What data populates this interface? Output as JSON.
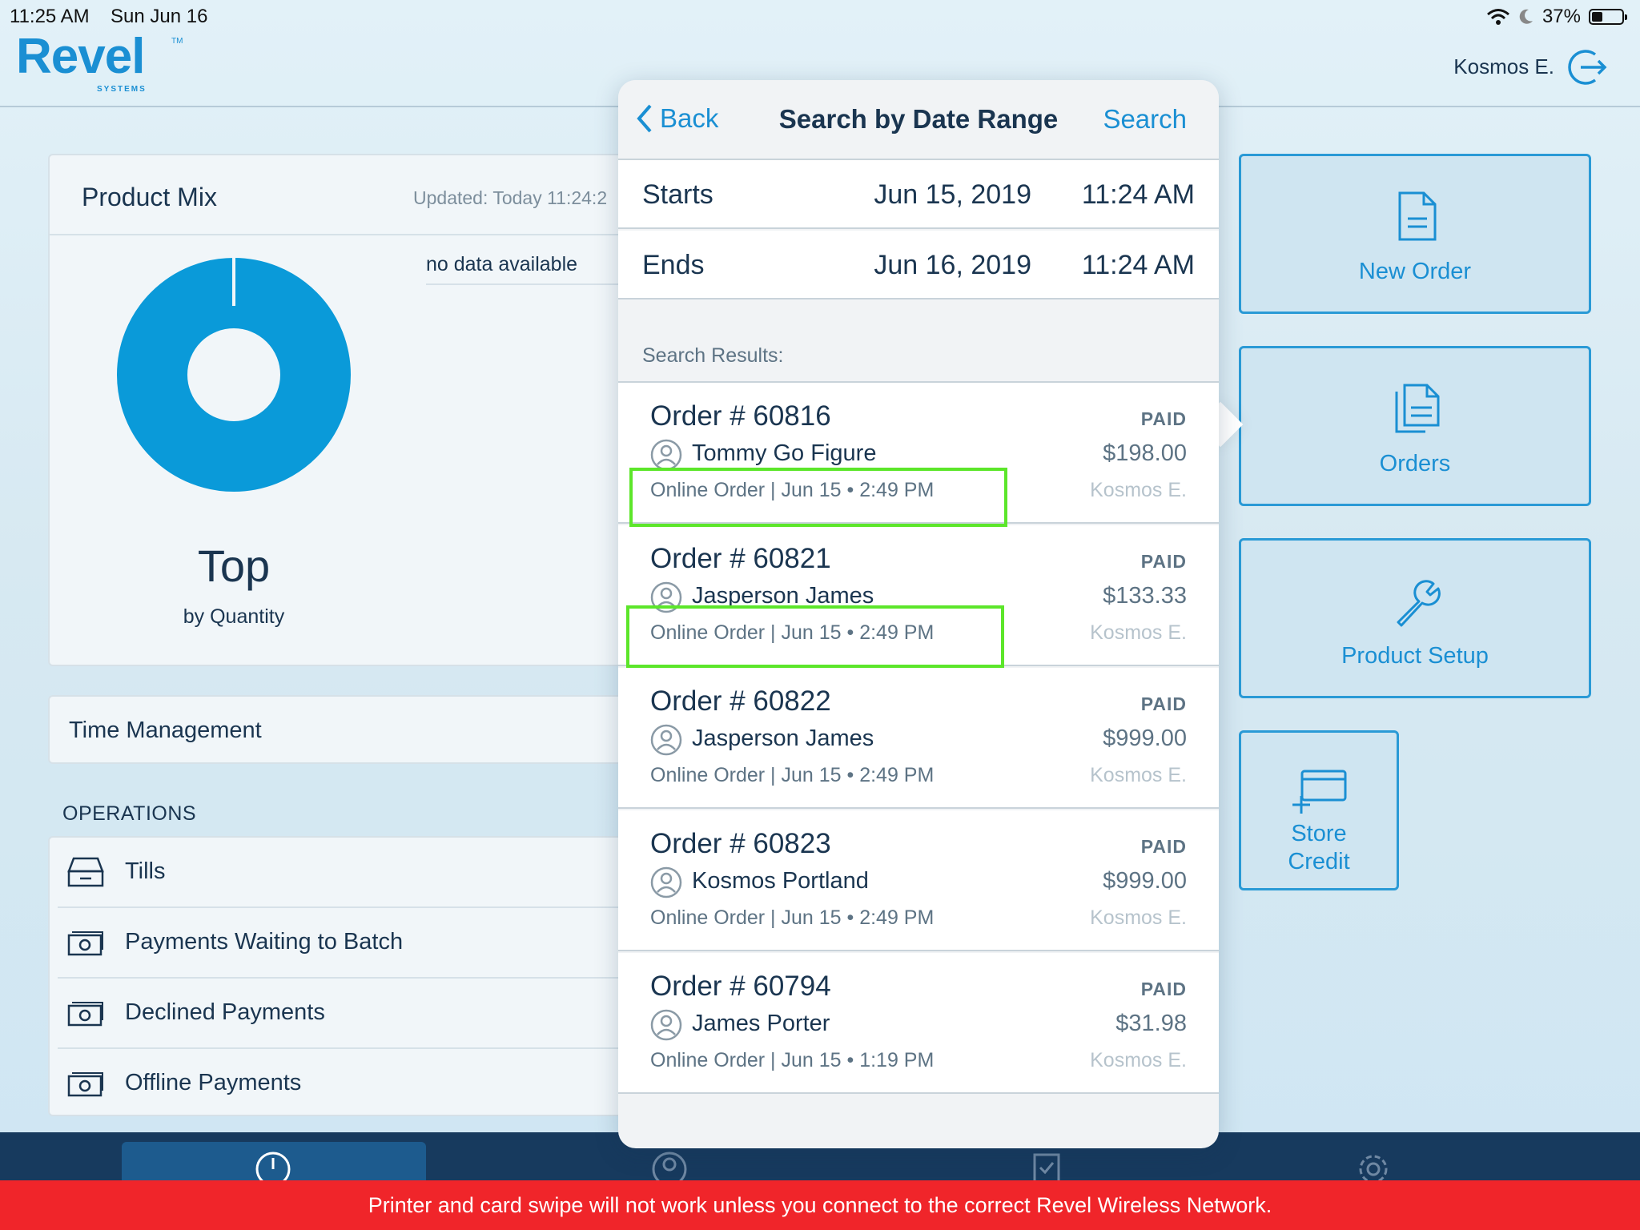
{
  "status_bar": {
    "time": "11:25 AM",
    "date": "Sun Jun 16",
    "battery": "37%",
    "battery_level": 0.37
  },
  "header": {
    "logo_main": "Revel",
    "logo_tm": "TM",
    "logo_sub": "SYSTEMS",
    "user_name": "Kosmos E."
  },
  "product_mix": {
    "title": "Product Mix",
    "updated": "Updated: Today 11:24:2",
    "no_data": "no data available",
    "top": "Top",
    "by": "by Quantity"
  },
  "time_management": {
    "label": "Time Management"
  },
  "operations": {
    "title": "OPERATIONS",
    "items": [
      {
        "label": "Tills",
        "icon": "till-drawer-icon"
      },
      {
        "label": "Payments Waiting to Batch",
        "icon": "cash-icon"
      },
      {
        "label": "Declined Payments",
        "icon": "cash-icon"
      },
      {
        "label": "Offline Payments",
        "icon": "cash-icon"
      }
    ]
  },
  "actions": {
    "new_order": "New Order",
    "orders": "Orders",
    "product_setup": "Product Setup",
    "store_credit_line1": "Store",
    "store_credit_line2": "Credit"
  },
  "popover": {
    "back": "Back",
    "title": "Search by Date Range",
    "search": "Search",
    "starts": {
      "label": "Starts",
      "date": "Jun 15, 2019",
      "time": "11:24 AM"
    },
    "ends": {
      "label": "Ends",
      "date": "Jun 16, 2019",
      "time": "11:24 AM"
    },
    "results_label": "Search Results:",
    "orders": [
      {
        "number": "Order # 60816",
        "status": "PAID",
        "customer": "Tommy Go Figure",
        "amount": "$198.00",
        "meta": "Online Order | Jun 15 • 2:49 PM",
        "staff": "Kosmos E."
      },
      {
        "number": "Order # 60821",
        "status": "PAID",
        "customer": "Jasperson James",
        "amount": "$133.33",
        "meta": "Online Order | Jun 15 • 2:49 PM",
        "staff": "Kosmos E."
      },
      {
        "number": "Order # 60822",
        "status": "PAID",
        "customer": "Jasperson James",
        "amount": "$999.00",
        "meta": "Online Order | Jun 15 • 2:49 PM",
        "staff": "Kosmos E."
      },
      {
        "number": "Order # 60823",
        "status": "PAID",
        "customer": "Kosmos Portland",
        "amount": "$999.00",
        "meta": "Online Order | Jun 15 • 2:49 PM",
        "staff": "Kosmos E."
      },
      {
        "number": "Order # 60794",
        "status": "PAID",
        "customer": "James Porter",
        "amount": "$31.98",
        "meta": "Online Order | Jun 15 • 1:19 PM",
        "staff": "Kosmos E."
      }
    ]
  },
  "bottom_nav": {
    "icons": [
      "dashboard-icon",
      "customer-icon",
      "clipboard-icon",
      "settings-icon"
    ]
  },
  "warning": "Printer and card swipe will not work unless you connect to the correct Revel Wireless Network.",
  "colors": {
    "accent": "#1a8fd3",
    "donut": "#0a9ad9",
    "nav": "#173a5e",
    "warning": "#f0252a",
    "highlight": "#5ce62a"
  }
}
